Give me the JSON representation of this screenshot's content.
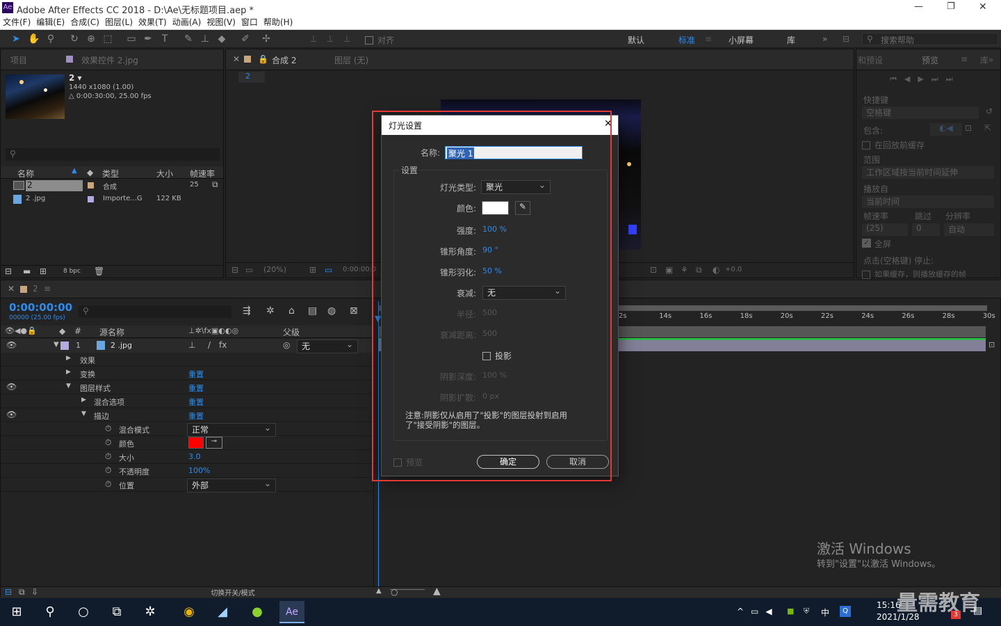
{
  "window": {
    "title": "Adobe After Effects CC 2018 - D:\\Ae\\无标题项目.aep *",
    "min": "—",
    "max": "❐",
    "close": "✕"
  },
  "menu": [
    "文件(F)",
    "编辑(E)",
    "合成(C)",
    "图层(L)",
    "效果(T)",
    "动画(A)",
    "视图(V)",
    "窗口",
    "帮助(H)"
  ],
  "toolbar": {
    "snap_label": "对齐",
    "workspaces": [
      "默认",
      "标准",
      "小屏幕",
      "库"
    ],
    "active_workspace": "标准",
    "search_placeholder": "搜索帮助"
  },
  "project_panel": {
    "tab_project": "项目",
    "tab_effects": "效果控件 2.jpg",
    "comp_name": "2 ▾",
    "comp_size": "1440 x1080 (1.00)",
    "comp_duration": "△ 0:00:30:00, 25.00 fps",
    "columns": [
      "名称",
      "类型",
      "大小",
      "帧速率"
    ],
    "items": [
      {
        "name": "2",
        "type": "合成",
        "size": "",
        "fps": "25"
      },
      {
        "name": "2 .jpg",
        "type": "Importe...G",
        "size": "122 KB",
        "fps": ""
      }
    ],
    "bpc": "8 bpc"
  },
  "comp_panel": {
    "tab_comp": "合成 2",
    "tab_layer": "图层 (无)",
    "crumb": "2",
    "zoom": "(20%)",
    "time": "0:00:00:0",
    "exposure": "+0.0"
  },
  "right_panel": {
    "tab_info": "和预设",
    "tab_preview": "预览",
    "tab_lib": "库",
    "shortcut_label": "快捷键",
    "shortcut_value": "空格键",
    "include_label": "包含:",
    "cache_label": "在回放前缓存",
    "range_label": "范围",
    "range_value": "工作区域按当前时间延伸",
    "play_from_label": "播放自",
    "play_from_value": "当前时间",
    "fps_label": "帧速率",
    "skip_label": "跳过",
    "res_label": "分辨率",
    "fps_value": "(25)",
    "skip_value": "0",
    "res_value": "自动",
    "fullscreen_label": "全屏",
    "stop_label": "点击(空格键) 停止:",
    "cached_label": "如果缓存，则播放缓存的帧"
  },
  "timeline": {
    "timecode": "0:00:00:00",
    "frames": "00000 (25.00 fps)",
    "col_source": "源名称",
    "col_parent": "父级",
    "layer": {
      "num": "1",
      "name": "2 .jpg",
      "parent": "无"
    },
    "props": [
      {
        "label": "效果",
        "value": ""
      },
      {
        "label": "变换",
        "value": "重置"
      },
      {
        "label": "图层样式",
        "value": "重置"
      },
      {
        "label": "混合选项",
        "value": "重置"
      },
      {
        "label": "描边",
        "value": "重置"
      },
      {
        "label": "混合模式",
        "value": "正常"
      },
      {
        "label": "颜色",
        "value": ""
      },
      {
        "label": "大小",
        "value": "3.0"
      },
      {
        "label": "不透明度",
        "value": "100%"
      },
      {
        "label": "位置",
        "value": "外部"
      }
    ],
    "ruler": [
      "2s",
      "14s",
      "16s",
      "18s",
      "20s",
      "22s",
      "24s",
      "26s",
      "28s",
      "30s"
    ],
    "toggle_label": "切换开关/模式"
  },
  "dialog": {
    "title": "灯光设置",
    "close": "✕",
    "name_label": "名称:",
    "name_value": "聚光 1",
    "group_label": "设置",
    "type_label": "灯光类型:",
    "type_value": "聚光",
    "color_label": "颜色:",
    "intensity_label": "强度:",
    "intensity_value": "100 %",
    "cone_label": "锥形角度:",
    "cone_value": "90 °",
    "feather_label": "锥形羽化:",
    "feather_value": "50 %",
    "falloff_label": "衰减:",
    "falloff_value": "无",
    "radius_label": "半径:",
    "radius_value": "500",
    "distance_label": "衰减距离:",
    "distance_value": "500",
    "shadow_label": "投影",
    "depth_label": "阴影深度:",
    "depth_value": "100 %",
    "diffusion_label": "阴影扩散:",
    "diffusion_value": "0 px",
    "note": "注意:阴影仅从启用了\"投影\"的图层投射到启用了\"接受阴影\"的图层。",
    "preview_label": "预览",
    "ok": "确定",
    "cancel": "取消"
  },
  "watermark": {
    "line1": "激活 Windows",
    "line2": "转到\"设置\"以激活 Windows。",
    "brand": "量需教育"
  },
  "taskbar": {
    "time": "15:16",
    "date": "2021/1/28",
    "ime": "中",
    "notif": "3"
  },
  "colors": {
    "accent": "#2d8ceb",
    "highlight": "#e53935",
    "stroke_color": "#ff0000"
  }
}
